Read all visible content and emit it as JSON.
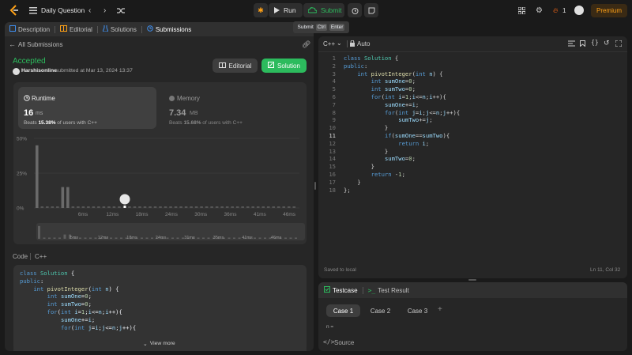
{
  "topbar": {
    "problem_list": "Daily Question",
    "run": "Run",
    "submit": "Submit",
    "streak": "1",
    "premium": "Premium"
  },
  "tooltip": {
    "label": "Submit",
    "key1": "Ctrl",
    "key2": "Enter"
  },
  "left_tabs": [
    {
      "label": "Description"
    },
    {
      "label": "Editorial"
    },
    {
      "label": "Solutions"
    },
    {
      "label": "Submissions"
    }
  ],
  "submission": {
    "back": "All Submissions",
    "status": "Accepted",
    "user": "Harshisonline",
    "submitted": "submitted at Mar 13, 2024 13:37",
    "editorial_btn": "Editorial",
    "solution_btn": "Solution"
  },
  "runtime": {
    "title": "Runtime",
    "value": "16",
    "unit": "ms",
    "beats_pre": "Beats ",
    "beats_pct": "15.38%",
    "beats_post": " of users with C++"
  },
  "memory": {
    "title": "Memory",
    "value": "7.34",
    "unit": "MB",
    "beats_pre": "Beats ",
    "beats_pct": "15.68%",
    "beats_post": " of users with C++"
  },
  "chart_data": {
    "type": "bar",
    "yticks": [
      "50%",
      "25%",
      "0%"
    ],
    "xticks": [
      "6ms",
      "12ms",
      "18ms",
      "24ms",
      "30ms",
      "36ms",
      "41ms",
      "46ms"
    ],
    "ylim": [
      0,
      50
    ],
    "values": [
      45,
      1,
      1,
      1,
      1,
      15,
      15,
      1,
      1,
      1,
      1,
      1,
      1,
      1,
      1,
      1,
      1,
      1,
      1,
      1,
      1,
      1,
      1,
      1,
      1,
      1,
      1,
      1,
      1,
      1,
      1,
      1,
      1,
      1,
      1,
      1,
      1,
      1,
      1,
      1,
      1,
      1,
      1,
      1,
      1,
      1,
      1,
      1,
      1,
      1,
      1
    ],
    "mini_xticks": [
      "5ms",
      "12ms",
      "18ms",
      "24ms",
      "31ms",
      "35ms",
      "41ms",
      "46ms"
    ]
  },
  "code_section": {
    "label": "Code",
    "lang": "C++",
    "view_more": "View more"
  },
  "code_preview": [
    "class Solution {",
    "public:",
    "    int pivotInteger(int n) {",
    "        int sumOne=0;",
    "        int sumTwo=0;",
    "        for(int i=1;i<=n;i++){",
    "            sumOne+=i;",
    "            for(int j=i;j<=n;j++){"
  ],
  "editor": {
    "lang": "C++",
    "mode": "Auto",
    "saved": "Saved to local",
    "cursor": "Ln 11, Col 32"
  },
  "editor_lines": [
    "class Solution {",
    "public:",
    "    int pivotInteger(int n) {",
    "        int sumOne=0;",
    "        int sumTwo=0;",
    "        for(int i=1;i<=n;i++){",
    "            sumOne+=i;",
    "            for(int j=i;j<=n;j++){",
    "                sumTwo+=j;",
    "            }",
    "            if(sumOne==sumTwo){",
    "                return i;",
    "            }",
    "            sumTwo=0;",
    "        }",
    "        return -1;",
    "    }",
    "};"
  ],
  "testcase": {
    "tab1": "Testcase",
    "tab2": "Test Result",
    "cases": [
      "Case 1",
      "Case 2",
      "Case 3"
    ],
    "input_label": "n =",
    "source": "Source"
  },
  "colors": {
    "accent_green": "#2cbb5d",
    "orange": "#ffa116",
    "blue": "#3f8ff0"
  }
}
